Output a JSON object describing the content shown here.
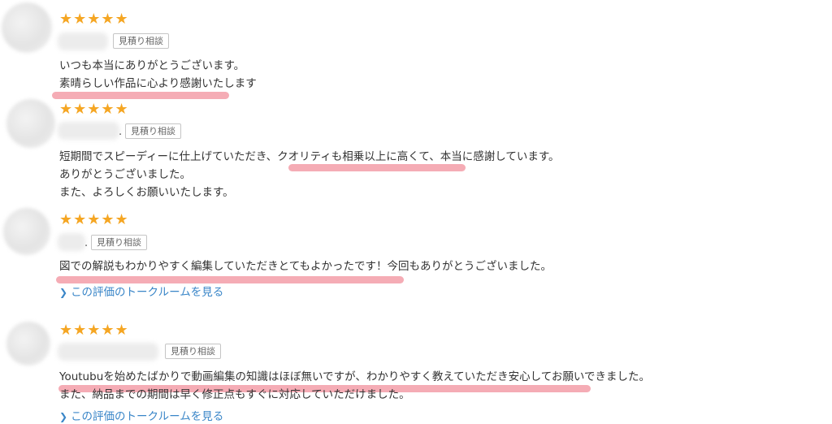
{
  "reviews": [
    {
      "stars": "★★★★★",
      "badge": "見積り相談",
      "lines": [
        "いつも本当にありがとうございます。",
        "素晴らしい作品に心より感謝いたします"
      ]
    },
    {
      "stars": "★★★★★",
      "name_suffix": ".",
      "badge": "見積り相談",
      "lines": [
        "短期間でスピーディーに仕上げていただき、クオリティも相乗以上に高くて、本当に感謝しています。",
        "ありがとうございました。",
        "また、よろしくお願いいたします。"
      ]
    },
    {
      "stars": "★★★★★",
      "name_suffix": ".",
      "badge": "見積り相談",
      "lines": [
        "図での解説もわかりやすく編集していただきとてもよかったです！今回もありがとうございました。"
      ],
      "link_icon": "chevron-right-icon",
      "link_label": "この評価のトークルームを見る"
    },
    {
      "stars": "★★★★★",
      "badge": "見積り相談",
      "lines": [
        "Youtubuを始めたばかりで動画編集の知識はほぼ無いですが、わかりやすく教えていただき安心してお願いできました。",
        "また、納品までの期間は早く修正点もすぐに対応していただけました。"
      ],
      "link_icon": "chevron-right-icon",
      "link_label": "この評価のトークルームを見る"
    }
  ],
  "colors": {
    "star": "#f5a623",
    "highlight": "#f4a3ad",
    "link": "#3a86c8"
  }
}
